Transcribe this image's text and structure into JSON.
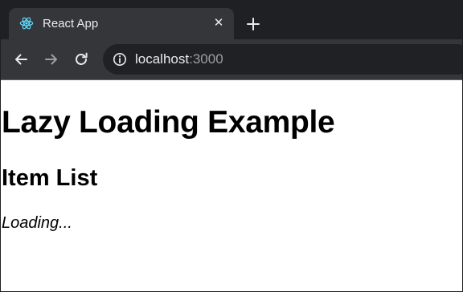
{
  "browser": {
    "tab": {
      "title": "React App",
      "close_glyph": "✕",
      "favicon": "react-icon"
    },
    "toolbar": {
      "back_icon": "arrow-left-icon",
      "forward_icon": "arrow-right-icon",
      "reload_icon": "reload-icon",
      "new_tab_icon": "plus-icon",
      "info_icon": "info-icon"
    },
    "address": {
      "host": "localhost",
      "port": ":3000"
    }
  },
  "page": {
    "heading": "Lazy Loading Example",
    "subheading": "Item List",
    "status": "Loading..."
  },
  "colors": {
    "titlebar": "#1f2023",
    "tab_active": "#35363a",
    "toolbar": "#35363a",
    "omnibox": "#202124",
    "text_light": "#e8eaed",
    "text_dim": "#9aa0a6",
    "react_accent": "#61dafb",
    "page_background": "#ffffff"
  }
}
